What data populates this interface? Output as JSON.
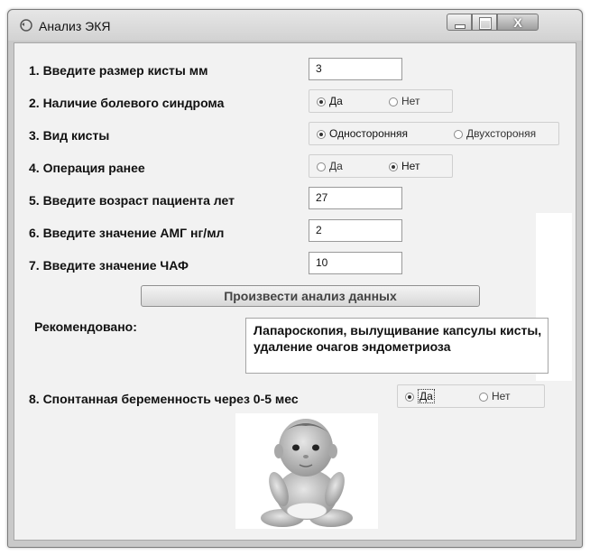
{
  "window": {
    "title": "Анализ ЭКЯ",
    "close_glyph": "X",
    "icon": "app-refresh-icon"
  },
  "fields": {
    "cyst_size": {
      "label": "1. Введите размер кисты мм",
      "value": "3"
    },
    "age": {
      "label": "5. Введите возраст пациента лет",
      "value": "27"
    },
    "amh": {
      "label": "6. Введите значение АМГ нг/мл",
      "value": "2"
    },
    "chaf": {
      "label": "7. Введите значение ЧАФ",
      "value": "10"
    }
  },
  "radio_groups": {
    "pain": {
      "label": "2. Наличие болевого синдрома",
      "options": [
        "Да",
        "Нет"
      ],
      "selected": "Да"
    },
    "cyst_type": {
      "label": "3. Вид кисты",
      "options": [
        "Односторонняя",
        "Двухстороняя"
      ],
      "selected": "Односторонняя"
    },
    "surgery": {
      "label": "4. Операция ранее",
      "options": [
        "Да",
        "Нет"
      ],
      "selected": "Нет"
    },
    "pregnancy": {
      "label": "8. Спонтанная беременность через 0-5 мес",
      "options": [
        "Да",
        "Нет"
      ],
      "selected": "Да"
    }
  },
  "analyze_button": "Произвести анализ данных",
  "recommendation": {
    "label": "Рекомендовано:",
    "text": "Лапароскопия, вылущивание капсулы кисты, удаление очагов эндометриоза"
  },
  "image": {
    "subject": "baby-photo"
  },
  "colors": {
    "window_chrome": "#c9c9c9",
    "client_bg": "#f2f2f2"
  }
}
